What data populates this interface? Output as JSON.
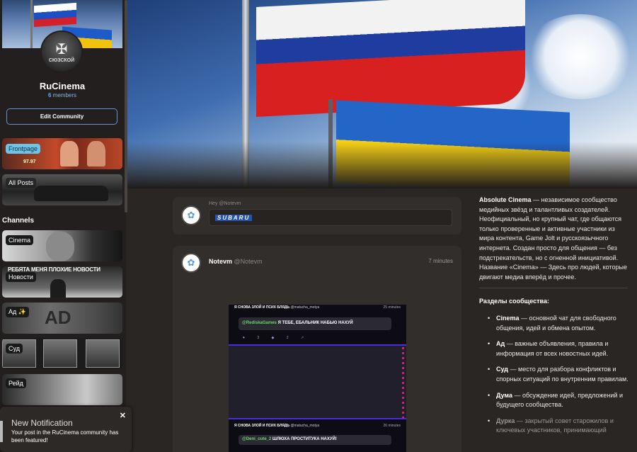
{
  "community": {
    "name": "RuCinema",
    "members_count": "6",
    "members_label": "members",
    "avatar_label": "СЮЗСКОЙ",
    "edit_button": "Edit Community"
  },
  "nav": {
    "frontpage": "Frontpage",
    "frontpage_price": "97.97",
    "all_posts": "All Posts"
  },
  "channels": {
    "title": "Channels",
    "items": [
      {
        "label": "Cinema"
      },
      {
        "label": "Новости",
        "headline": "РЕБЯТА  МЕНЯ ПЛОХИЕ НОВОСТИ"
      },
      {
        "label": "Ад ✨",
        "art": "AD"
      },
      {
        "label": "Суд"
      },
      {
        "label": "Рейд"
      }
    ]
  },
  "notification": {
    "title": "New Notification",
    "body": "Your post in the RuCinema community has been featured!",
    "close": "✕"
  },
  "composer": {
    "greeting": "Hey @Notevm",
    "tag": "SUBARU"
  },
  "post": {
    "username": "Notevm",
    "handle": "@Notevm",
    "time": "7 minutes",
    "screenshot": {
      "top_header": "Я СНОВА ЗЛОЙ И ПСИХ БЛЯДЬ",
      "top_handle": "@matucha_motya",
      "top_time": "25 minutes",
      "top_user": "@RediskaGames",
      "top_text": "Я ТЕБЕ, ЕБАЛЬНИК НАБЬЮ НАХУЙ",
      "icons": "♥ 3   ◆ 2   ↗",
      "bottom_header": "Я СНОВА ЗЛОЙ И ПСИХ БЛЯДЬ",
      "bottom_handle": "@matucha_motya",
      "bottom_time": "26 minutes",
      "bottom_user": "@Deni_cute_2",
      "bottom_text": "ШЛЮХА ПРОСТИТУКА НАХУЙ!"
    }
  },
  "about": {
    "name_bold": "Absolute Cinema",
    "intro": " — независимое сообщество медийных звёзд и талантливых создателей. Неофициальный, но крупный чат, где общаются только проверенные и активные участники из мира контента, Game Jolt и русскоязычного интернета. Создан просто для общения — без подстрекательств, но с огненной инициативой. Название «Cinema» — Здесь про людей, которые двигают медиа вперёд и прочее.",
    "sections_title": "Разделы сообщества:",
    "sections": [
      {
        "name": "Cinema",
        "desc": " — основной чат для свободного общения, идей и обмена опытом."
      },
      {
        "name": "Ад",
        "desc": " — важные объявления, правила и информация от всех новостных идей."
      },
      {
        "name": "Суд",
        "desc": " — место для разбора конфликтов и спорных ситуаций по внутренним правилам."
      },
      {
        "name": "Дума",
        "desc": " — обсуждение идей, предложений и будущего сообщества."
      },
      {
        "name": "Дурка",
        "desc": " — закрытый совет старожилов и ключевых участников, принимающий"
      }
    ]
  }
}
